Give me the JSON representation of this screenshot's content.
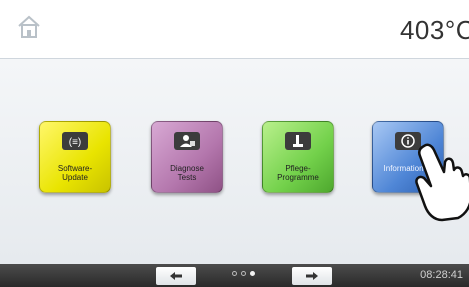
{
  "header": {
    "home_icon": "home-icon",
    "temperature": "403°C"
  },
  "tiles": [
    {
      "label": "Software-\nUpdate",
      "icon": "software-update-icon",
      "color": "#e9e400"
    },
    {
      "label": "Diagnose\nTests",
      "icon": "diagnose-icon",
      "color": "#b477ad"
    },
    {
      "label": "Pflege-\nProgramme",
      "icon": "care-program-icon",
      "color": "#73d14b"
    },
    {
      "label": "Informationen",
      "icon": "info-icon",
      "color": "#4f86d6"
    }
  ],
  "footer": {
    "prev_icon": "arrow-left-icon",
    "next_icon": "arrow-right-icon",
    "page_count": 3,
    "active_page": 3,
    "time": "08:28:41"
  }
}
